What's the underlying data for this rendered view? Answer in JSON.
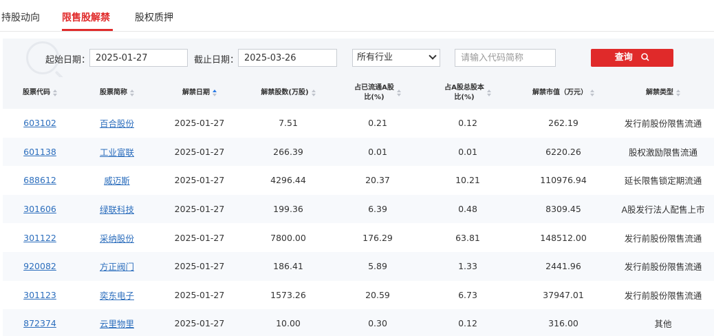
{
  "tabs": [
    {
      "label": "持股动向"
    },
    {
      "label": "限售股解禁"
    },
    {
      "label": "股权质押"
    }
  ],
  "filters": {
    "start_label": "起始日期：",
    "start_value": "2025-01-27",
    "end_label": "截止日期：",
    "end_value": "2025-03-26",
    "industry_selected": "所有行业",
    "search_placeholder": "请输入代码简称",
    "search_button": "查询"
  },
  "table": {
    "headers": [
      {
        "line1": "股票代码",
        "line2": ""
      },
      {
        "line1": "股票简称",
        "line2": ""
      },
      {
        "line1": "解禁日期",
        "line2": ""
      },
      {
        "line1": "解禁股数(万股)",
        "line2": ""
      },
      {
        "line1": "占已流通A股",
        "line2": "比(%)"
      },
      {
        "line1": "占A股总股本",
        "line2": "比(%)"
      },
      {
        "line1": "解禁市值（万元）",
        "line2": ""
      },
      {
        "line1": "解禁类型",
        "line2": ""
      }
    ],
    "sorted_column": "解禁日期",
    "rows": [
      {
        "code": "603102",
        "name": "百合股份",
        "date": "2025-01-27",
        "shares": "7.51",
        "float_pct": "0.21",
        "total_pct": "0.12",
        "value": "262.19",
        "type": "发行前股份限售流通"
      },
      {
        "code": "601138",
        "name": "工业富联",
        "date": "2025-01-27",
        "shares": "266.39",
        "float_pct": "0.01",
        "total_pct": "0.01",
        "value": "6220.26",
        "type": "股权激励限售流通"
      },
      {
        "code": "688612",
        "name": "威迈斯",
        "date": "2025-01-27",
        "shares": "4296.44",
        "float_pct": "20.37",
        "total_pct": "10.21",
        "value": "110976.94",
        "type": "延长限售锁定期流通"
      },
      {
        "code": "301606",
        "name": "绿联科技",
        "date": "2025-01-27",
        "shares": "199.36",
        "float_pct": "6.39",
        "total_pct": "0.48",
        "value": "8309.45",
        "type": "A股发行法人配售上市"
      },
      {
        "code": "301122",
        "name": "采纳股份",
        "date": "2025-01-27",
        "shares": "7800.00",
        "float_pct": "176.29",
        "total_pct": "63.81",
        "value": "148512.00",
        "type": "发行前股份限售流通"
      },
      {
        "code": "920082",
        "name": "方正阀门",
        "date": "2025-01-27",
        "shares": "186.41",
        "float_pct": "5.89",
        "total_pct": "1.33",
        "value": "2441.96",
        "type": "发行前股份限售流通"
      },
      {
        "code": "301123",
        "name": "奕东电子",
        "date": "2025-01-27",
        "shares": "1573.26",
        "float_pct": "20.59",
        "total_pct": "6.73",
        "value": "37947.01",
        "type": "发行前股份限售流通"
      },
      {
        "code": "872374",
        "name": "云里物里",
        "date": "2025-01-27",
        "shares": "10.00",
        "float_pct": "0.30",
        "total_pct": "0.12",
        "value": "316.00",
        "type": "其他"
      }
    ]
  },
  "colors": {
    "accent": "#e02a2a",
    "link": "#2c6ebd",
    "header_bg": "#f4f6f9"
  }
}
